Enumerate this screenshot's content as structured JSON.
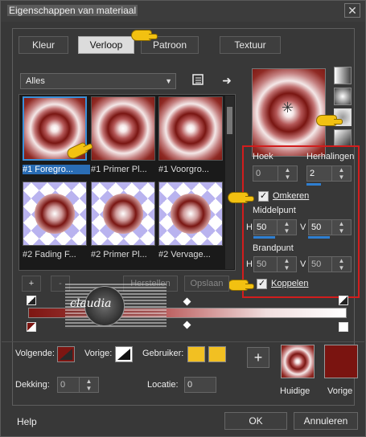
{
  "window": {
    "title": "Eigenschappen van materiaal",
    "close_glyph": "✕"
  },
  "tabs": [
    {
      "label": "Kleur",
      "active": false
    },
    {
      "label": "Verloop",
      "active": true
    },
    {
      "label": "Patroon",
      "active": false
    },
    {
      "label": "Textuur",
      "active": false
    }
  ],
  "category": {
    "selected": "Alles"
  },
  "gallery": {
    "items": [
      {
        "caption": "#1 Foregro...",
        "style": "radial",
        "selected": true
      },
      {
        "caption": "#1 Primer Pl...",
        "style": "radial",
        "selected": false
      },
      {
        "caption": "#1 Voorgro...",
        "style": "radial",
        "selected": false
      },
      {
        "caption": "#2 Fading F...",
        "style": "check",
        "selected": false
      },
      {
        "caption": "#2 Primer Pl...",
        "style": "check",
        "selected": false
      },
      {
        "caption": "#2 Vervage...",
        "style": "check",
        "selected": false
      }
    ]
  },
  "gallery_buttons": {
    "add": "+",
    "remove": "-",
    "reset": "Herstellen",
    "save": "Opslaan"
  },
  "settings": {
    "angle_label": "Hoek",
    "angle_value": "0",
    "repeats_label": "Herhalingen",
    "repeats_value": "2",
    "invert_label": "Omkeren",
    "invert_checked": true,
    "center_label": "Middelpunt",
    "center_h_label": "H",
    "center_h_value": "50",
    "center_v_label": "V",
    "center_v_value": "50",
    "focal_label": "Brandpunt",
    "focal_h_label": "H",
    "focal_h_value": "50",
    "focal_v_label": "V",
    "focal_v_value": "50",
    "link_label": "Koppelen",
    "link_checked": true
  },
  "watermark": {
    "text": "claudia"
  },
  "bottom": {
    "next_label": "Volgende:",
    "prev_label": "Vorige:",
    "user_label": "Gebruiker:",
    "opacity_label": "Dekking:",
    "opacity_value": "0",
    "location_label": "Locatie:",
    "location_value": "0",
    "current_label": "Huidige",
    "previous_label": "Vorige",
    "add_symbol": "+"
  },
  "colors": {
    "foreground": "#7d1612",
    "user1": "#f2c022",
    "user2": "#f2c022",
    "previous_swatch": "#7a1410",
    "accent": "#2f7fd1",
    "highlight": "#d21d1d"
  },
  "footer": {
    "help": "Help",
    "ok": "OK",
    "cancel": "Annuleren"
  },
  "icons": [
    "hand-pointer-icon",
    "list-options-icon",
    "arrow-right-icon",
    "star-crosshair-icon"
  ]
}
